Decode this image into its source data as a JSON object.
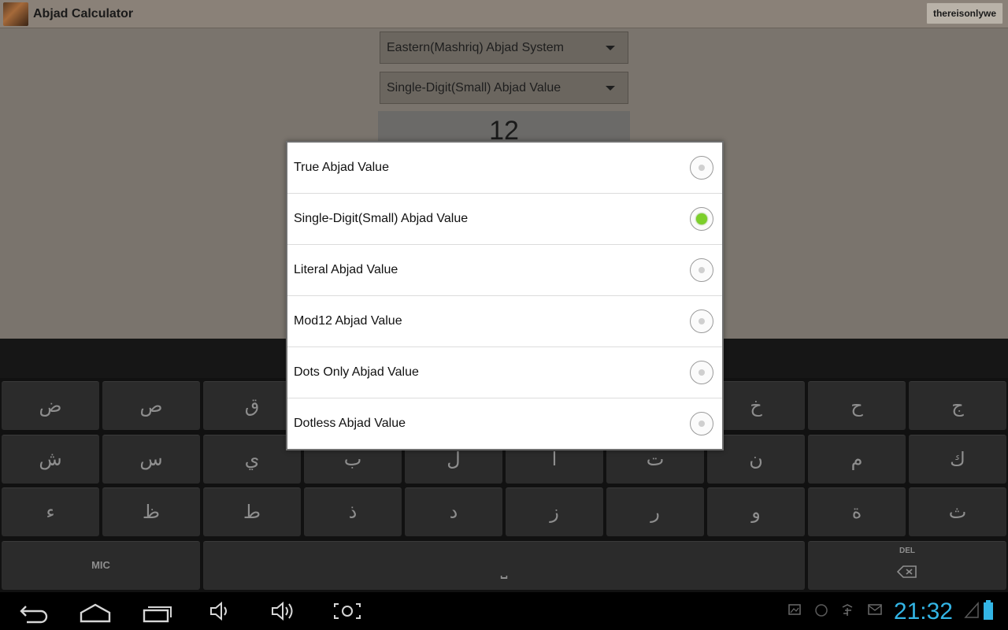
{
  "app": {
    "title": "Abjad Calculator",
    "account_button": "thereisonlywe",
    "system_spinner": "Eastern(Mashriq) Abjad System",
    "value_spinner": "Single-Digit(Small) Abjad Value",
    "result": "12"
  },
  "dialog": {
    "options": [
      {
        "label": "True Abjad Value",
        "checked": false
      },
      {
        "label": "Single-Digit(Small) Abjad Value",
        "checked": true
      },
      {
        "label": "Literal Abjad Value",
        "checked": false
      },
      {
        "label": "Mod12 Abjad Value",
        "checked": false
      },
      {
        "label": "Dots Only Abjad Value",
        "checked": false
      },
      {
        "label": "Dotless Abjad Value",
        "checked": false
      }
    ]
  },
  "keyboard": {
    "row1": [
      "ض",
      "ص",
      "ق",
      "",
      "",
      "",
      "",
      "خ",
      "ح",
      "ج"
    ],
    "row2": [
      "ش",
      "س",
      "ي",
      "ب",
      "ل",
      "ا",
      "ت",
      "ن",
      "م",
      "ك"
    ],
    "row3": [
      "ء",
      "ظ",
      "ط",
      "ذ",
      "د",
      "ز",
      "ر",
      "و",
      "ة",
      "ث"
    ],
    "mic_label": "MIC",
    "space_label": "⎵",
    "del_label": "DEL"
  },
  "status": {
    "time": "21:32",
    "accent": "#33b5e5",
    "radio_checked_color": "#7ccf2a"
  }
}
